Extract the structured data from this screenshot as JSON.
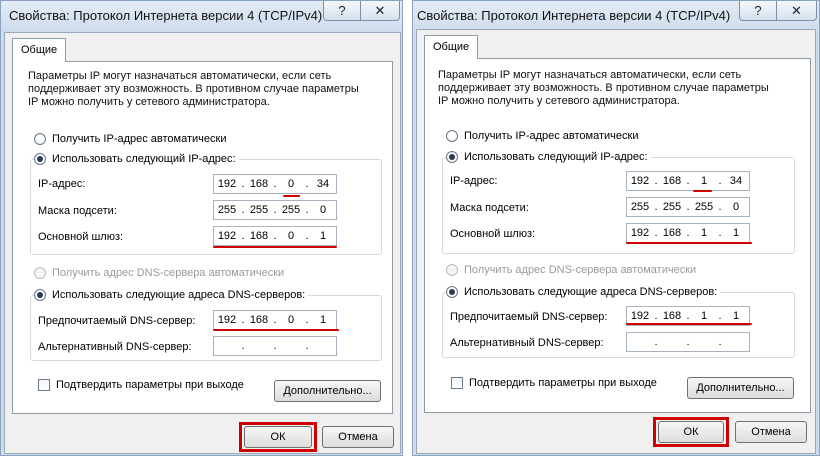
{
  "colors": {
    "highlight": "#d00000",
    "frame": "#cddceb"
  },
  "dialogs": [
    {
      "title": "Свойства: Протокол Интернета версии 4 (TCP/IPv4)",
      "help_icon": "help-icon",
      "help_glyph": "?",
      "close_icon": "close-icon",
      "close_glyph": "✕",
      "tab": "Общие",
      "description": "Параметры IP могут назначаться автоматически, если сеть\nподдерживает эту возможность. В противном случае параметры\nIP можно получить у сетевого администратора.",
      "radio_ip_auto": "Получить IP-адрес автоматически",
      "radio_ip_manual": "Использовать следующий IP-адрес:",
      "ip_label": "IP-адрес:",
      "ip_value": [
        "192",
        "168",
        "0",
        "34"
      ],
      "mask_label": "Маска подсети:",
      "mask_value": [
        "255",
        "255",
        "255",
        "0"
      ],
      "gateway_label": "Основной шлюз:",
      "gateway_value": [
        "192",
        "168",
        "0",
        "1"
      ],
      "radio_dns_auto": "Получить адрес DNS-сервера автоматически",
      "radio_dns_manual": "Использовать следующие адреса DNS-серверов:",
      "dns_pref_label": "Предпочитаемый DNS-сервер:",
      "dns_pref_value": [
        "192",
        "168",
        "0",
        "1"
      ],
      "dns_alt_label": "Альтернативный DNS-сервер:",
      "dns_alt_value": [
        "",
        "",
        "",
        ""
      ],
      "validate_label": "Подтвердить параметры при выходе",
      "advanced_button": "Дополнительно...",
      "ok_button": "ОК",
      "cancel_button": "Отмена"
    },
    {
      "title": "Свойства: Протокол Интернета версии 4 (TCP/IPv4)",
      "help_icon": "help-icon",
      "help_glyph": "?",
      "close_icon": "close-icon",
      "close_glyph": "✕",
      "tab": "Общие",
      "description": "Параметры IP могут назначаться автоматически, если сеть\nподдерживает эту возможность. В противном случае параметры\nIP можно получить у сетевого администратора.",
      "radio_ip_auto": "Получить IP-адрес автоматически",
      "radio_ip_manual": "Использовать следующий IP-адрес:",
      "ip_label": "IP-адрес:",
      "ip_value": [
        "192",
        "168",
        "1",
        "34"
      ],
      "mask_label": "Маска подсети:",
      "mask_value": [
        "255",
        "255",
        "255",
        "0"
      ],
      "gateway_label": "Основной шлюз:",
      "gateway_value": [
        "192",
        "168",
        "1",
        "1"
      ],
      "radio_dns_auto": "Получить адрес DNS-сервера автоматически",
      "radio_dns_manual": "Использовать следующие адреса DNS-серверов:",
      "dns_pref_label": "Предпочитаемый DNS-сервер:",
      "dns_pref_value": [
        "192",
        "168",
        "1",
        "1"
      ],
      "dns_alt_label": "Альтернативный DNS-сервер:",
      "dns_alt_value": [
        "",
        "",
        "",
        ""
      ],
      "validate_label": "Подтвердить параметры при выходе",
      "advanced_button": "Дополнительно...",
      "ok_button": "ОК",
      "cancel_button": "Отмена"
    }
  ]
}
